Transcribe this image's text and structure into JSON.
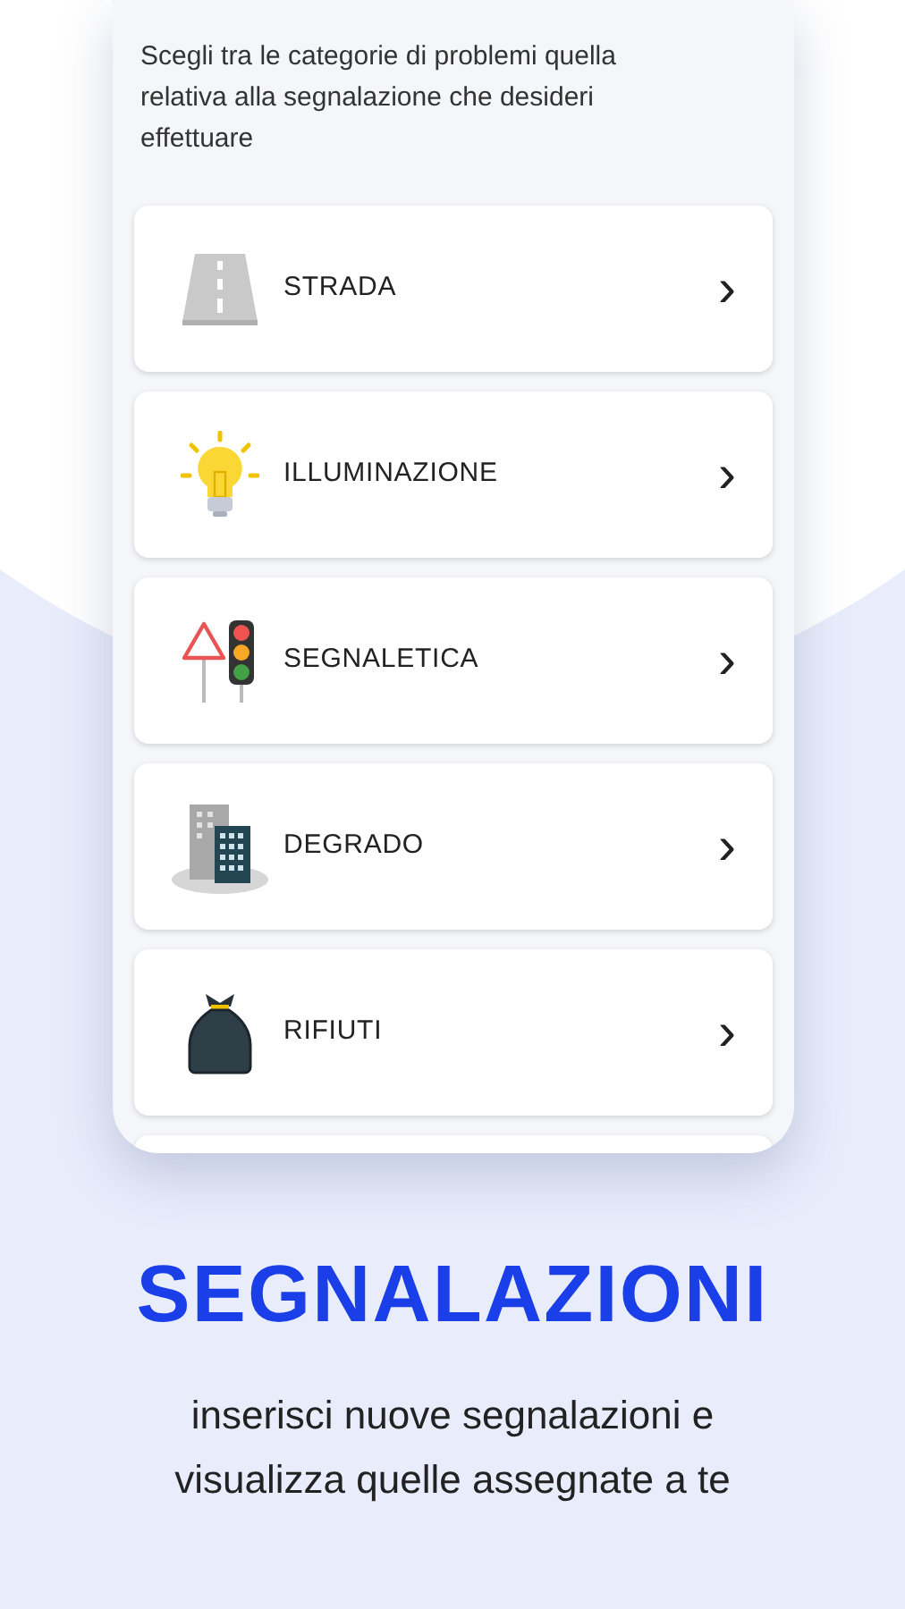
{
  "screen": {
    "intro": "Scegli tra le categorie di problemi quella relativa alla segnalazione che desideri effettuare",
    "categories": [
      {
        "kind": "road",
        "label": "STRADA",
        "chevron": "›"
      },
      {
        "kind": "bulb",
        "label": "ILLUMINAZIONE",
        "chevron": "›"
      },
      {
        "kind": "signs",
        "label": "SEGNALETICA",
        "chevron": "›"
      },
      {
        "kind": "buildings",
        "label": "DEGRADO",
        "chevron": "›"
      },
      {
        "kind": "trash",
        "label": "RIFIUTI",
        "chevron": "›"
      }
    ]
  },
  "headline": "SEGNALAZIONI",
  "tagline": "inserisci nuove segnalazioni e visualizza quelle assegnate a te"
}
